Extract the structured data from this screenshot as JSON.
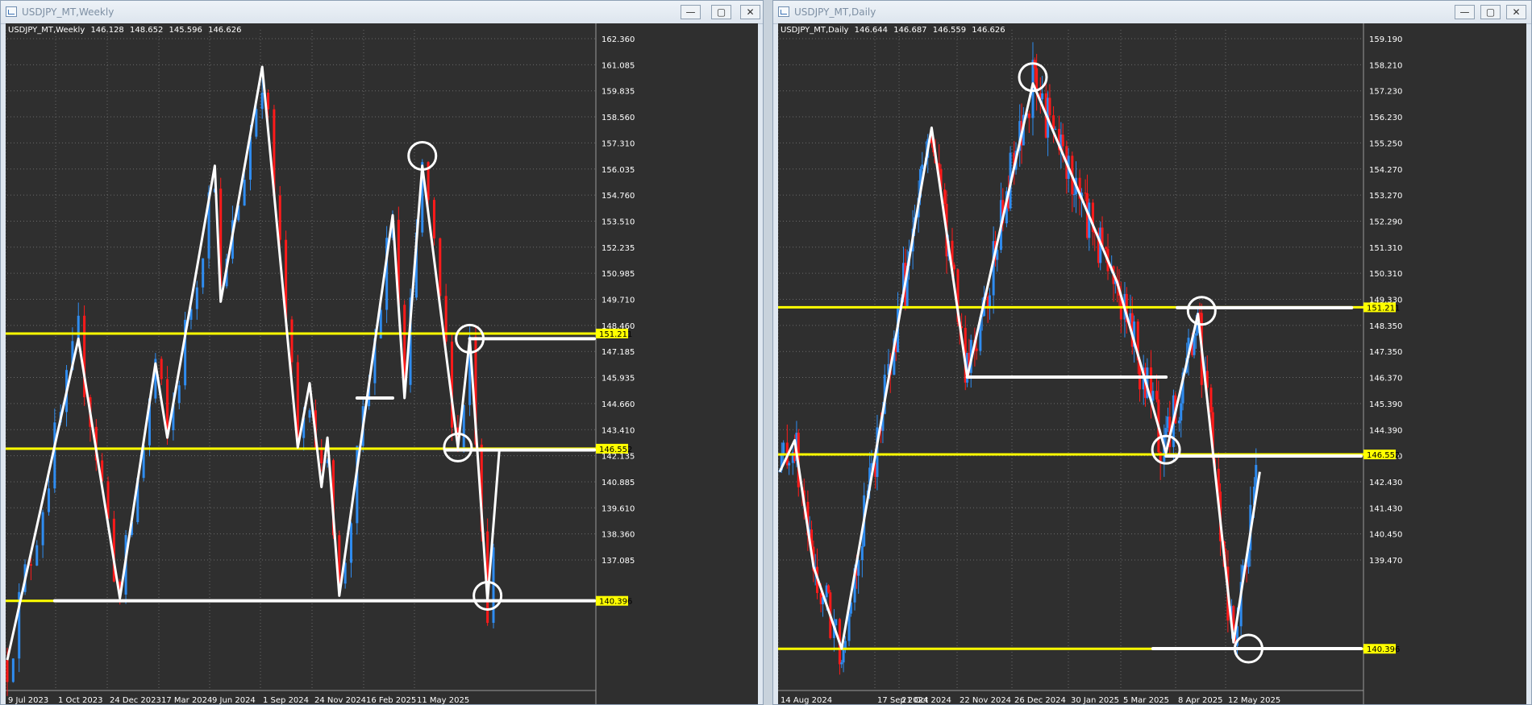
{
  "colors": {
    "bull": "#2f8cf0",
    "bear": "#ff1a1a",
    "level": "#ffff00",
    "path": "#ffffff",
    "background": "#2f2f2f",
    "grid": "#6a6a6a"
  },
  "windows": [
    {
      "title": "USDJPY_MT,Weekly",
      "symbol_label": "USDJPY_MT,Weekly",
      "ohlc": {
        "open": "146.128",
        "high": "148.652",
        "low": "145.596",
        "close": "146.626"
      },
      "buttons": {
        "minimize": "—",
        "restore": "▢",
        "close": "✕"
      },
      "price_ticks": [
        "162.360",
        "161.085",
        "159.835",
        "158.560",
        "157.310",
        "156.035",
        "154.760",
        "153.510",
        "152.235",
        "150.985",
        "149.710",
        "148.460",
        "147.185",
        "145.935",
        "144.660",
        "143.410",
        "142.135",
        "140.885",
        "139.610",
        "138.360",
        "137.085"
      ],
      "date_ticks": [
        "9 Jul 2023",
        "1 Oct 2023",
        "24 Dec 2023",
        "17 Mar 2024",
        "9 Jun 2024",
        "1 Sep 2024",
        "24 Nov 2024",
        "16 Feb 2025",
        "11 May 2025"
      ],
      "levels": [
        {
          "price": 151.211,
          "label": "151.211"
        },
        {
          "price": 146.552,
          "label": "146.552"
        },
        {
          "price": 140.396,
          "label": "140.396"
        }
      ],
      "chart_data": {
        "type": "candlestick",
        "timeframe": "Weekly",
        "ylim": [
          136.8,
          163.5
        ],
        "x_range": [
          "2023-07-09",
          "2025-06-01"
        ],
        "zigzag": [
          [
            "2023-07-09",
            138.0
          ],
          [
            "2023-10-01",
            151.0
          ],
          [
            "2023-11-19",
            140.5
          ],
          [
            "2023-12-31",
            150.0
          ],
          [
            "2024-01-14",
            147.0
          ],
          [
            "2024-03-10",
            158.0
          ],
          [
            "2024-03-17",
            152.5
          ],
          [
            "2024-05-05",
            162.0
          ],
          [
            "2024-06-16",
            146.6
          ],
          [
            "2024-06-30",
            149.2
          ],
          [
            "2024-07-14",
            145.0
          ],
          [
            "2024-07-21",
            147.0
          ],
          [
            "2024-08-04",
            140.6
          ],
          [
            "2024-10-06",
            156.0
          ],
          [
            "2024-10-20",
            148.6
          ],
          [
            "2024-11-10",
            158.0
          ],
          [
            "2024-12-22",
            146.6
          ],
          [
            "2025-01-05",
            151.0
          ],
          [
            "2025-01-26",
            140.4
          ],
          [
            "2025-02-09",
            146.5
          ]
        ],
        "circles": [
          [
            "2024-11-10",
            158.4
          ],
          [
            "2025-01-05",
            151.0
          ],
          [
            "2024-12-22",
            146.6
          ],
          [
            "2025-01-26",
            140.6
          ]
        ],
        "horizontal_segments": [
          {
            "from": "2024-08-25",
            "to": "2024-10-06",
            "price": 148.6
          },
          {
            "from": "2025-01-05",
            "to": "2025-06-01",
            "price": 151.0
          },
          {
            "from": "2024-12-08",
            "to": "2025-06-01",
            "price": 146.5
          },
          {
            "from": "2023-09-03",
            "to": "2025-06-01",
            "price": 140.4
          }
        ]
      }
    },
    {
      "title": "USDJPY_MT,Daily",
      "symbol_label": "USDJPY_MT,Daily",
      "ohlc": {
        "open": "146.644",
        "high": "146.687",
        "low": "146.559",
        "close": "146.626"
      },
      "buttons": {
        "minimize": "—",
        "restore": "▢",
        "close": "✕"
      },
      "price_ticks": [
        "159.190",
        "158.210",
        "157.230",
        "156.230",
        "155.250",
        "154.270",
        "153.270",
        "152.290",
        "151.310",
        "150.310",
        "149.330",
        "148.350",
        "147.350",
        "146.370",
        "145.390",
        "144.390",
        "143.410",
        "142.430",
        "141.430",
        "140.450",
        "139.470"
      ],
      "date_ticks": [
        "14 Aug 2024",
        "17 Sep 2024",
        "21 Oct 2024",
        "22 Nov 2024",
        "26 Dec 2024",
        "30 Jan 2025",
        "5 Mar 2025",
        "8 Apr 2025",
        "12 May 2025"
      ],
      "levels": [
        {
          "price": 151.211,
          "label": "151.211"
        },
        {
          "price": 146.552,
          "label": "146.552"
        },
        {
          "price": 140.396,
          "label": "140.396"
        }
      ],
      "chart_data": {
        "type": "candlestick",
        "timeframe": "Daily",
        "ylim": [
          139.1,
          160.0
        ],
        "x_range": [
          "2024-08-14",
          "2025-06-20"
        ],
        "zigzag": [
          [
            "2024-08-14",
            146.0
          ],
          [
            "2024-08-22",
            147.0
          ],
          [
            "2024-09-01",
            143.0
          ],
          [
            "2024-09-16",
            140.4
          ],
          [
            "2024-10-20",
            152.0
          ],
          [
            "2024-10-27",
            154.5
          ],
          [
            "2024-11-03",
            156.9
          ],
          [
            "2024-11-22",
            149.0
          ],
          [
            "2024-12-27",
            158.3
          ],
          [
            "2025-02-10",
            152.0
          ],
          [
            "2025-03-08",
            146.6
          ],
          [
            "2025-03-25",
            151.0
          ],
          [
            "2025-04-13",
            140.6
          ],
          [
            "2025-04-27",
            146.0
          ]
        ],
        "circles": [
          [
            "2024-12-27",
            158.5
          ],
          [
            "2025-03-27",
            151.1
          ],
          [
            "2025-03-08",
            146.7
          ],
          [
            "2025-04-21",
            140.4
          ]
        ],
        "horizontal_segments": [
          {
            "from": "2024-11-22",
            "to": "2025-03-08",
            "price": 149.0
          },
          {
            "from": "2025-03-14",
            "to": "2025-06-15",
            "price": 151.2
          },
          {
            "from": "2025-03-08",
            "to": "2025-06-20",
            "price": 146.5
          },
          {
            "from": "2025-03-01",
            "to": "2025-06-20",
            "price": 140.4
          }
        ]
      }
    }
  ]
}
